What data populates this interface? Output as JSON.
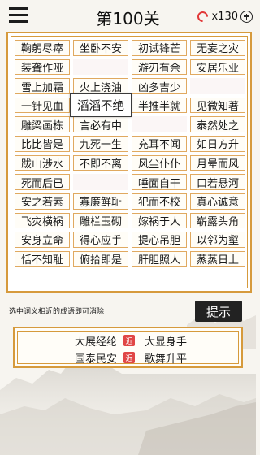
{
  "header": {
    "level_title": "第100关",
    "coins": "x130"
  },
  "board": {
    "cells": [
      "鞠躬尽瘁",
      "坐卧不安",
      "初试锋芒",
      "无妄之灾",
      "装聋作哑",
      "",
      "游刃有余",
      "安居乐业",
      "雪上加霜",
      "火上浇油",
      "凶多吉少",
      "",
      "一针见血",
      "滔滔不绝",
      "半推半就",
      "见微知著",
      "雕梁画栋",
      "言必有中",
      "",
      "泰然处之",
      "比比皆是",
      "九死一生",
      "充耳不闻",
      "如日方升",
      "跋山涉水",
      "不即不离",
      "风尘仆仆",
      "月晕而风",
      "死而后已",
      "",
      "唾面自干",
      "口若悬河",
      "安之若素",
      "寡廉鲜耻",
      "犯而不校",
      "真心诚意",
      "飞灾横祸",
      "雕栏玉砌",
      "嫁祸于人",
      "崭露头角",
      "安身立命",
      "得心应手",
      "提心吊胆",
      "以邻为壑",
      "恬不知耻",
      "俯拾即是",
      "肝胆照人",
      "蒸蒸日上"
    ],
    "selected_index": 13
  },
  "instruction": "选中词义相近的成语即可消除",
  "hint_label": "提示",
  "answers": [
    {
      "left": "大展经纶",
      "badge": "近",
      "right": "大显身手"
    },
    {
      "left": "国泰民安",
      "badge": "近",
      "right": "歌舞升平"
    }
  ]
}
